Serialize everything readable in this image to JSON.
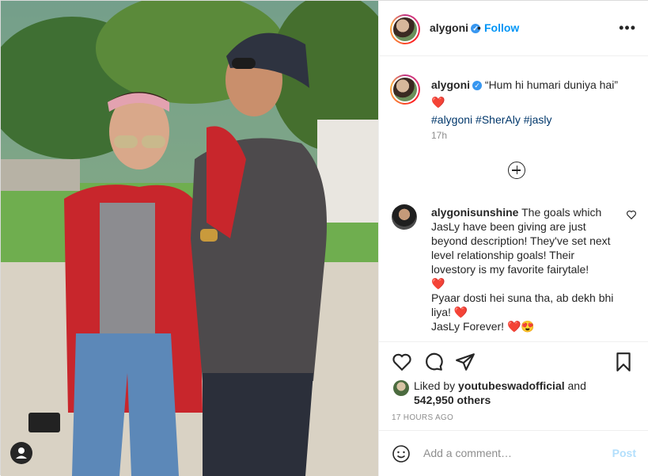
{
  "post": {
    "author": "alygoni",
    "follow_label": "Follow",
    "separator": "•",
    "more_label": "•••"
  },
  "caption": {
    "author": "alygoni",
    "text": "“Hum hi humari duniya hai”",
    "emoji": "❤️",
    "hashtags": "#alygoni #SherAly #jasly",
    "time": "17h"
  },
  "comment": {
    "author": "alygonisunshine",
    "text1": "The goals which JasLy have been giving are just beyond description! They've set next level relationship goals! Their lovestory is my favorite fairytale!",
    "heart1": "❤️",
    "text2": "Pyaar dosti hei suna tha, ab dekh bhi liya!",
    "heart2": "❤️",
    "text3": "JasLy Forever!",
    "emoji3": "❤️😍"
  },
  "likes": {
    "liked_by_prefix": "Liked by",
    "liked_by_user": "youtubeswadofficial",
    "and": "and",
    "others": "542,950 others",
    "ago": "17 HOURS AGO"
  },
  "add_comment": {
    "placeholder": "Add a comment…",
    "post_label": "Post"
  },
  "colors": {
    "accent": "#0095f6",
    "heart": "#ed4956",
    "muted": "#8e8e8e"
  },
  "icons": [
    "heart-icon",
    "comment-icon",
    "share-icon",
    "bookmark-icon",
    "emoji-icon",
    "verified-icon",
    "more-icon",
    "load-more-icon",
    "user-tag-icon"
  ]
}
